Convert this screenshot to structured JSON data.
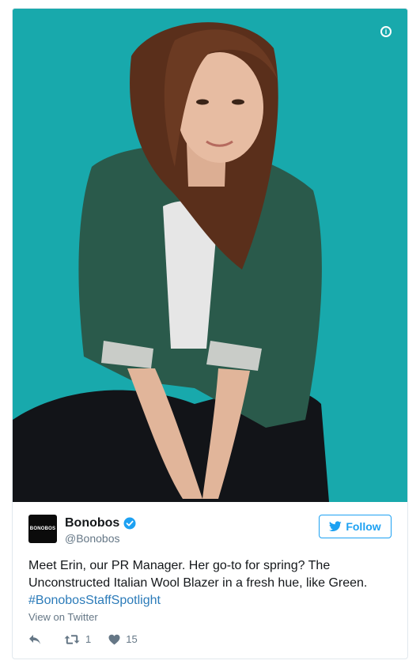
{
  "media": {
    "info_icon": "i"
  },
  "account": {
    "avatar_text": "BONOBOS",
    "name": "Bonobos",
    "handle": "@Bonobos",
    "verified": true
  },
  "follow_label": "Follow",
  "tweet": {
    "text": "Meet Erin, our PR Manager. Her go-to for spring? The Unconstructed Italian Wool Blazer in a fresh hue, like Green.",
    "hashtag": "#BonobosStaffSpotlight"
  },
  "view_on_twitter": "View on Twitter",
  "actions": {
    "retweets": "1",
    "likes": "15"
  },
  "colors": {
    "accent": "#1da1f2",
    "photo_background": "#18a9ac",
    "hashtag": "#2b7bb9"
  },
  "icons": [
    "info-icon",
    "verified-icon",
    "bird-icon",
    "reply-icon",
    "retweet-icon",
    "heart-icon"
  ]
}
